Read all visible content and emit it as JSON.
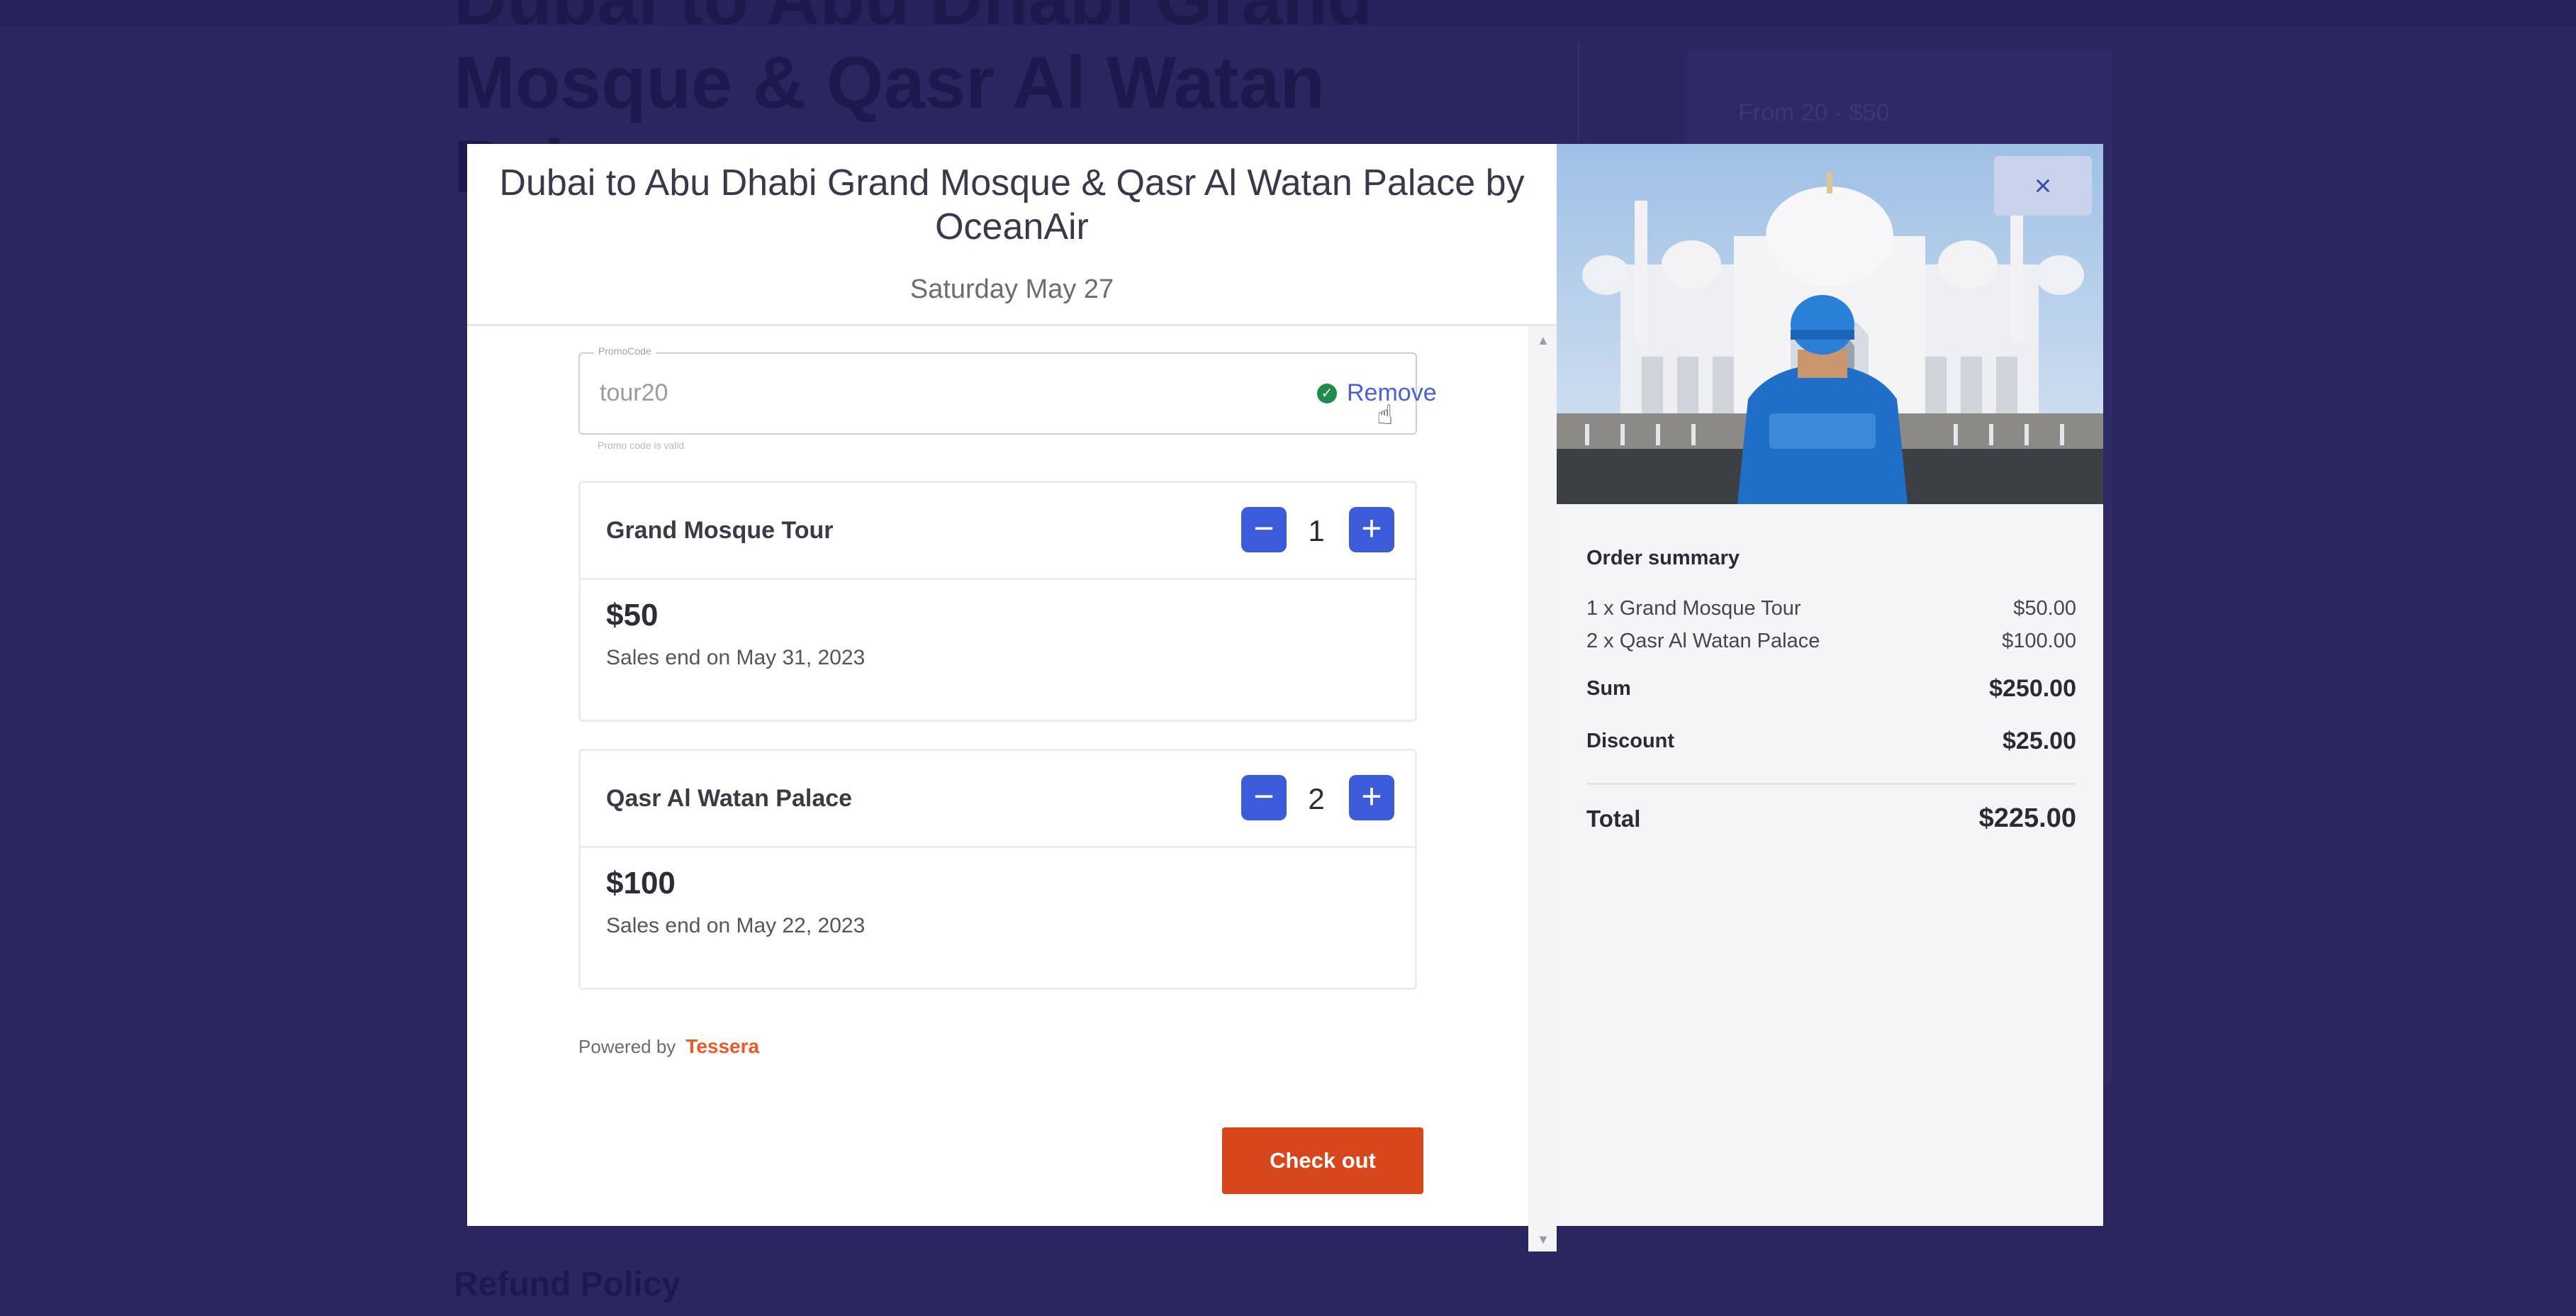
{
  "background_page": {
    "title": "Dubai to Abu Dhabi Grand Mosque & Qasr Al Watan Palace",
    "price_hint": "From 20 - $50",
    "refund_heading": "Refund Policy"
  },
  "modal": {
    "title": "Dubai to Abu Dhabi Grand Mosque & Qasr Al Watan Palace by OceanAir",
    "date": "Saturday May 27",
    "promo": {
      "label": "PromoCode",
      "value": "tour20",
      "remove_label": "Remove",
      "hint": "Promo code is valid"
    },
    "tickets": [
      {
        "name": "Grand Mosque Tour",
        "quantity": "1",
        "price": "$50",
        "sales_end": "Sales end on May 31, 2023"
      },
      {
        "name": "Qasr Al Watan Palace",
        "quantity": "2",
        "price": "$100",
        "sales_end": "Sales end on May 22, 2023"
      }
    ],
    "powered_by": "Powered by",
    "brand": "Tessera",
    "checkout_label": "Check out",
    "close_label": "×"
  },
  "summary": {
    "title": "Order summary",
    "lines": [
      {
        "label": "1 x Grand Mosque Tour",
        "amount": "$50.00"
      },
      {
        "label": "2 x Qasr Al Watan Palace",
        "amount": "$100.00"
      }
    ],
    "sum_label": "Sum",
    "sum_amount": "$250.00",
    "discount_label": "Discount",
    "discount_amount": "$25.00",
    "total_label": "Total",
    "total_amount": "$225.00"
  },
  "colors": {
    "accent": "#3b5bdb",
    "checkout": "#d8461b",
    "brand": "#e85a26",
    "overlay": "#2a2760"
  }
}
